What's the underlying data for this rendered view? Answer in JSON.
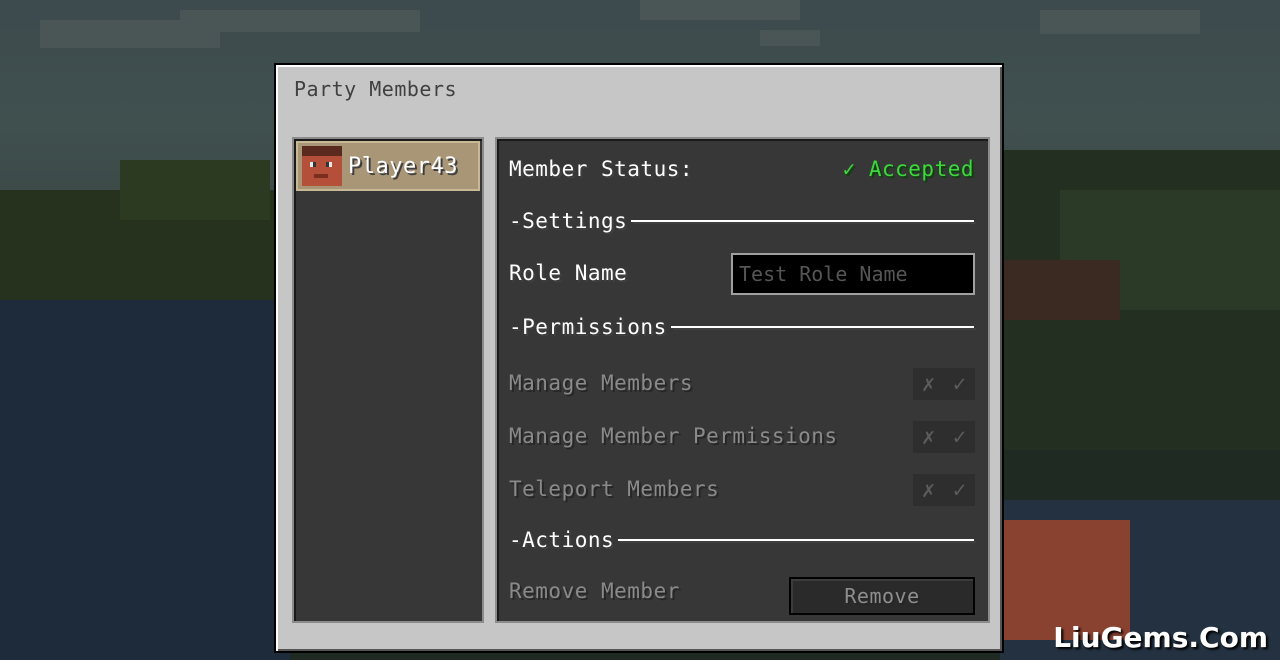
{
  "dialog": {
    "title": "Party Members"
  },
  "members": [
    {
      "name": "Player43",
      "selected": true
    }
  ],
  "details": {
    "status_label": "Member Status:",
    "status_value": "✓ Accepted",
    "status_color": "#3bd93b",
    "settings_title": "-Settings",
    "role_label": "Role Name",
    "role_input_placeholder": "Test Role Name",
    "permissions_title": "-Permissions",
    "permissions": [
      {
        "label": "Manage Members",
        "off_icon": "✗",
        "on_icon": "✓",
        "enabled": false
      },
      {
        "label": "Manage Member Permissions",
        "off_icon": "✗",
        "on_icon": "✓",
        "enabled": false
      },
      {
        "label": "Teleport Members",
        "off_icon": "✗",
        "on_icon": "✓",
        "enabled": false
      }
    ],
    "actions_title": "-Actions",
    "remove_label": "Remove Member",
    "remove_button": "Remove"
  },
  "watermark": "LiuGems.Com"
}
